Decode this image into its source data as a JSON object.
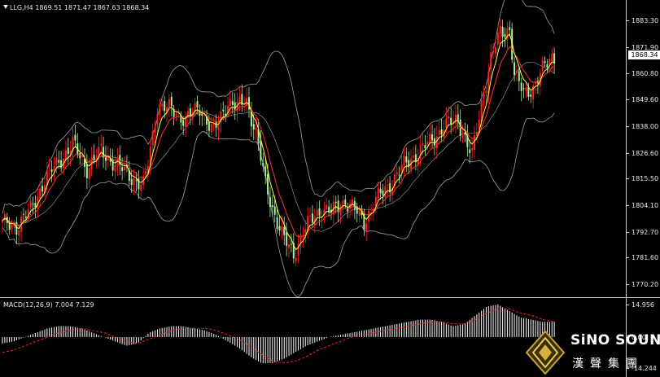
{
  "window": {
    "symbol_header": "LLG,H4  1869.51 1871.47 1867.63 1868.34",
    "dropdown_icon": "triangle-down-icon"
  },
  "price_axis": {
    "ticks": [
      "1883.30",
      "1871.90",
      "1860.80",
      "1849.60",
      "1838.00",
      "1826.60",
      "1815.50",
      "1804.10",
      "1792.70",
      "1781.60",
      "1770.20"
    ],
    "tick_values": [
      1883.3,
      1871.9,
      1860.8,
      1849.6,
      1838.0,
      1826.6,
      1815.5,
      1804.1,
      1792.7,
      1781.6,
      1770.2
    ],
    "current_price": "1868.34"
  },
  "macd": {
    "label": "MACD(12,26,9) 7.004 7.129",
    "ticks": [
      "14.956",
      "0.00",
      "-14.244"
    ],
    "tick_values": [
      14.956,
      0,
      -14.244
    ]
  },
  "brand": {
    "name": "SiNO SOUND",
    "chinese": "漢聲集團"
  },
  "colors": {
    "bull": "#ff2020",
    "bear": "#a8f0a0",
    "ma": "#ffff40",
    "ma_slow": "#ff3030",
    "bands": "#a0a0a0",
    "macd_hist": "#ffffff",
    "macd_signal": "#ff2020"
  },
  "chart_data": {
    "type": "candlestick",
    "instrument": "LLG",
    "timeframe": "H4",
    "ylim": [
      1767,
      1888
    ],
    "anchors": [
      [
        0,
        1796
      ],
      [
        6,
        1795
      ],
      [
        12,
        1802
      ],
      [
        18,
        1815
      ],
      [
        24,
        1823
      ],
      [
        30,
        1830
      ],
      [
        36,
        1820
      ],
      [
        42,
        1827
      ],
      [
        48,
        1822
      ],
      [
        54,
        1817
      ],
      [
        60,
        1812
      ],
      [
        62,
        1822
      ],
      [
        66,
        1847
      ],
      [
        72,
        1845
      ],
      [
        78,
        1841
      ],
      [
        84,
        1846
      ],
      [
        90,
        1835
      ],
      [
        96,
        1849
      ],
      [
        100,
        1846
      ],
      [
        104,
        1849
      ],
      [
        108,
        1835
      ],
      [
        112,
        1813
      ],
      [
        116,
        1800
      ],
      [
        120,
        1789
      ],
      [
        124,
        1783
      ],
      [
        128,
        1793
      ],
      [
        132,
        1798
      ],
      [
        136,
        1803
      ],
      [
        140,
        1801
      ],
      [
        146,
        1806
      ],
      [
        150,
        1802
      ],
      [
        154,
        1797
      ],
      [
        156,
        1801
      ],
      [
        158,
        1805
      ],
      [
        164,
        1812
      ],
      [
        170,
        1820
      ],
      [
        176,
        1826
      ],
      [
        182,
        1831
      ],
      [
        188,
        1838
      ],
      [
        194,
        1841
      ],
      [
        198,
        1830
      ],
      [
        200,
        1825
      ],
      [
        204,
        1848
      ],
      [
        208,
        1867
      ],
      [
        212,
        1878
      ],
      [
        216,
        1880
      ],
      [
        218,
        1860
      ],
      [
        222,
        1852
      ],
      [
        226,
        1855
      ],
      [
        230,
        1862
      ],
      [
        234,
        1868
      ]
    ],
    "macd_values": [
      -3,
      -2,
      0,
      2,
      4,
      5,
      5,
      4,
      2,
      0,
      -2,
      -4,
      -3,
      2,
      4,
      5,
      5,
      4,
      3,
      1,
      -2,
      -5,
      -9,
      -12,
      -12,
      -10,
      -7,
      -4,
      -2,
      0,
      1,
      2,
      3,
      4,
      5,
      6,
      7,
      8,
      8,
      7,
      5,
      6,
      10,
      14,
      15,
      12,
      9,
      8,
      7,
      7
    ],
    "signal_values": [
      -7,
      -6,
      -4,
      -2,
      0,
      2,
      3,
      4,
      3,
      2,
      0,
      -2,
      -3,
      -1,
      1,
      3,
      4,
      4,
      4,
      3,
      1,
      -1,
      -4,
      -8,
      -11,
      -12,
      -11,
      -9,
      -6,
      -4,
      -2,
      0,
      1,
      2,
      3,
      4,
      5,
      6,
      7,
      7,
      6,
      6,
      8,
      11,
      13,
      13,
      11,
      10,
      8,
      7
    ]
  }
}
